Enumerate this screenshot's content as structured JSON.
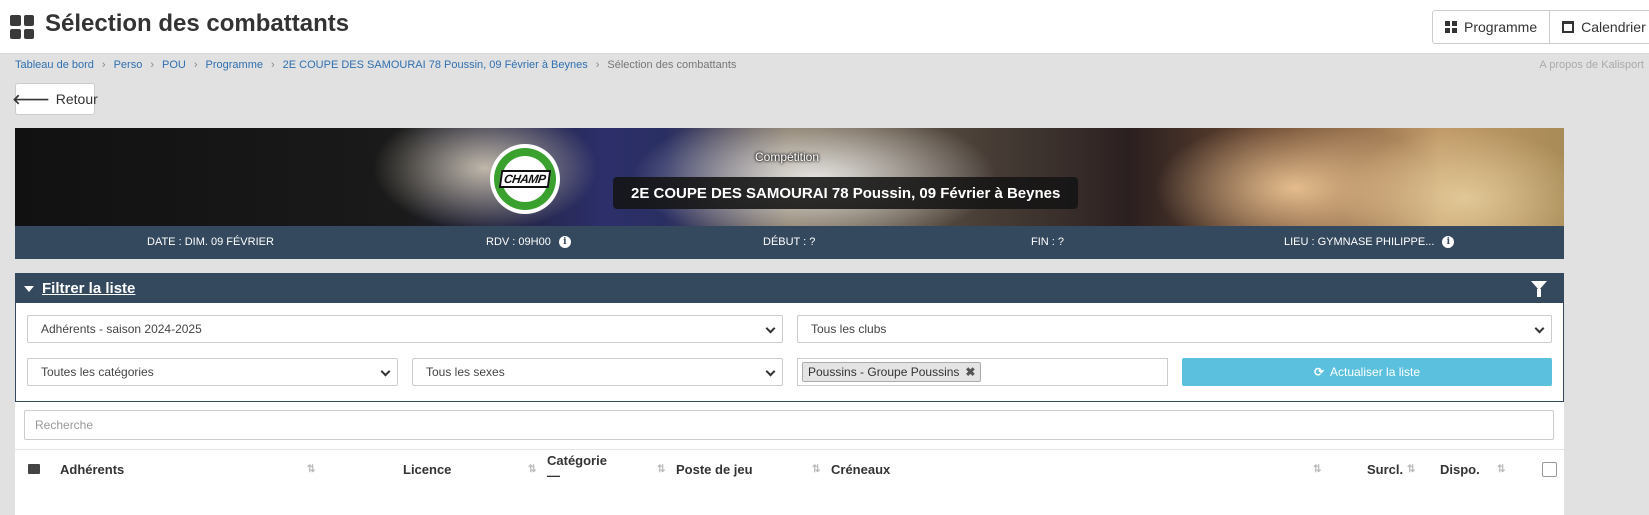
{
  "header": {
    "title": "Sélection des combattants",
    "buttons": {
      "programme": "Programme",
      "calendrier": "Calendrier"
    }
  },
  "breadcrumb": {
    "items": [
      "Tableau de bord",
      "Perso",
      "POU",
      "Programme",
      "2E COUPE DES SAMOURAI 78 Poussin, 09 Février à Beynes"
    ],
    "current": "Sélection des combattants",
    "about": "A propos de Kalisport"
  },
  "back_label": "Retour",
  "banner": {
    "logo_text": "CHAMP",
    "label": "Compétition",
    "title": "2E COUPE DES SAMOURAI 78 Poussin, 09 Février à Beynes"
  },
  "info": {
    "date": "DATE : DIM. 09 FÉVRIER",
    "rdv": "RDV : 09H00",
    "debut": "DÉBUT : ?",
    "fin": "FIN : ?",
    "lieu": "LIEU : GYMNASE PHILIPPE..."
  },
  "filter": {
    "title": "Filtrer la liste",
    "adherents": "Adhérents - saison 2024-2025",
    "clubs": "Tous les clubs",
    "categories": "Toutes les catégories",
    "sexes": "Tous les sexes",
    "group_tag": "Poussins - Groupe Poussins",
    "refresh": "Actualiser la liste"
  },
  "search_placeholder": "Recherche",
  "table": {
    "columns": {
      "adherents": "Adhérents",
      "licence": "Licence",
      "categorie": "Catégorie",
      "categorie_sub": "—",
      "poste": "Poste de jeu",
      "creneaux": "Créneaux",
      "surcl": "Surcl.",
      "dispo": "Dispo."
    }
  },
  "colors": {
    "accent": "#34495e",
    "link": "#2f6fb0",
    "info_button": "#5bc0de"
  }
}
